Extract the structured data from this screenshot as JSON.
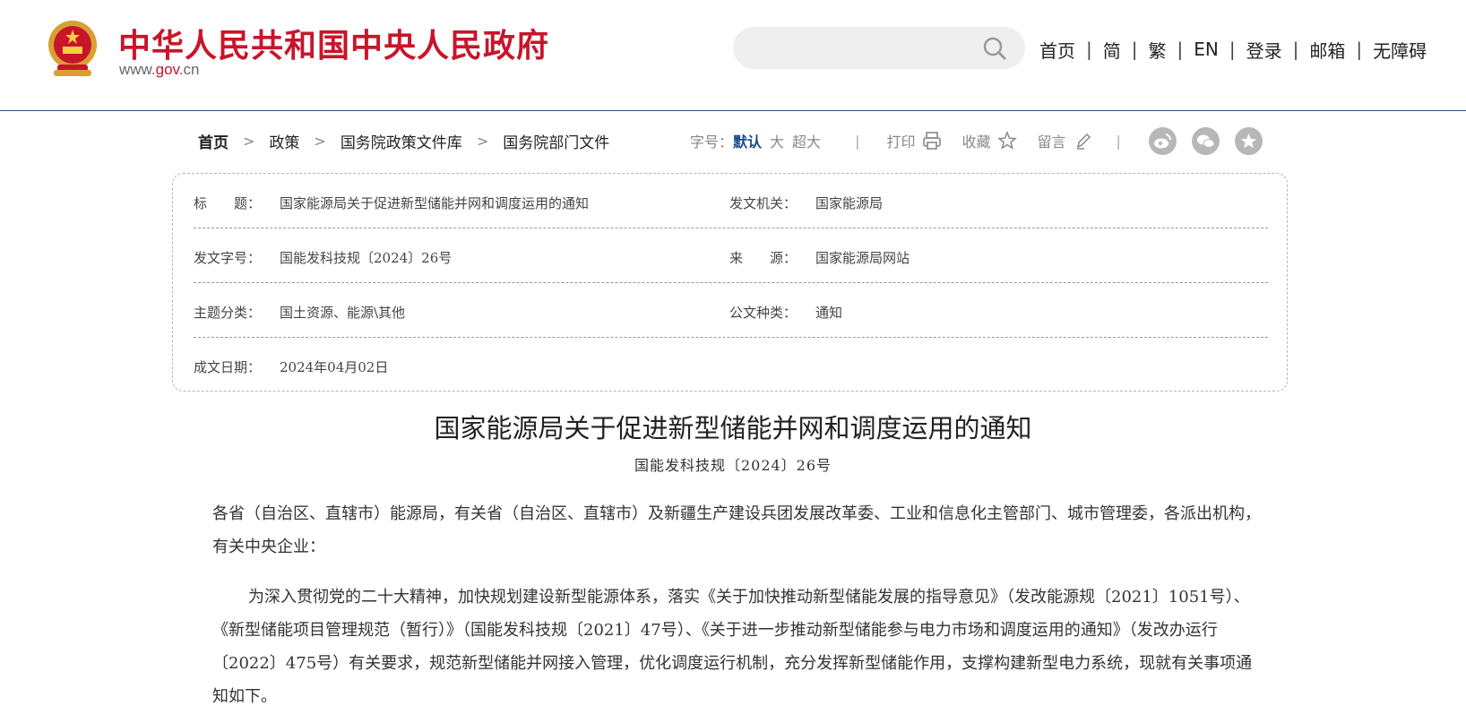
{
  "header": {
    "site_title": "中华人民共和国中央人民政府",
    "site_url_prefix": "www.",
    "site_url_domain": "gov",
    "site_url_suffix": ".cn",
    "brand_color": "#c8152a",
    "search_placeholder": "",
    "nav": [
      "首页",
      "简",
      "繁",
      "EN",
      "登录",
      "邮箱",
      "无障碍"
    ],
    "nav_sep": "|"
  },
  "breadcrumb": {
    "items": [
      "首页",
      "政策",
      "国务院政策文件库",
      "国务院部门文件"
    ],
    "arrow": ">"
  },
  "toolbar": {
    "font_size_label": "字号：",
    "font_sizes": [
      "默认",
      "大",
      "超大"
    ],
    "divider": "|",
    "print": "打印",
    "favorite": "收藏",
    "comment": "留言"
  },
  "social_icons": [
    "weibo-icon",
    "wechat-icon",
    "star-icon"
  ],
  "info": {
    "title_label": "标　　题：",
    "title_value": "国家能源局关于促进新型储能并网和调度运用的通知",
    "issuer_label": "发文机关：",
    "issuer_value": "国家能源局",
    "docno_label": "发文字号：",
    "docno_value": "国能发科技规〔2024〕26号",
    "source_label": "来　　源：",
    "source_value": "国家能源局网站",
    "topic_label": "主题分类：",
    "topic_value": "国土资源、能源\\其他",
    "type_label": "公文种类：",
    "type_value": "通知",
    "date_label": "成文日期：",
    "date_value": "2024年04月02日"
  },
  "article": {
    "title": "国家能源局关于促进新型储能并网和调度运用的通知",
    "doc_number": "国能发科技规〔2024〕26号",
    "addressee": "各省（自治区、直辖市）能源局，有关省（自治区、直辖市）及新疆生产建设兵团发展改革委、工业和信息化主管部门、城市管理委，各派出机构，有关中央企业：",
    "body_1": "为深入贯彻党的二十大精神，加快规划建设新型能源体系，落实《关于加快推动新型储能发展的指导意见》（发改能源规〔2021〕1051号）、《新型储能项目管理规范（暂行）》（国能发科技规〔2021〕47号）、《关于进一步推动新型储能参与电力市场和调度运用的通知》（发改办运行〔2022〕475号）有关要求，规范新型储能并网接入管理，优化调度运行机制，充分发挥新型储能作用，支撑构建新型电力系统，现就有关事项通知如下。"
  }
}
